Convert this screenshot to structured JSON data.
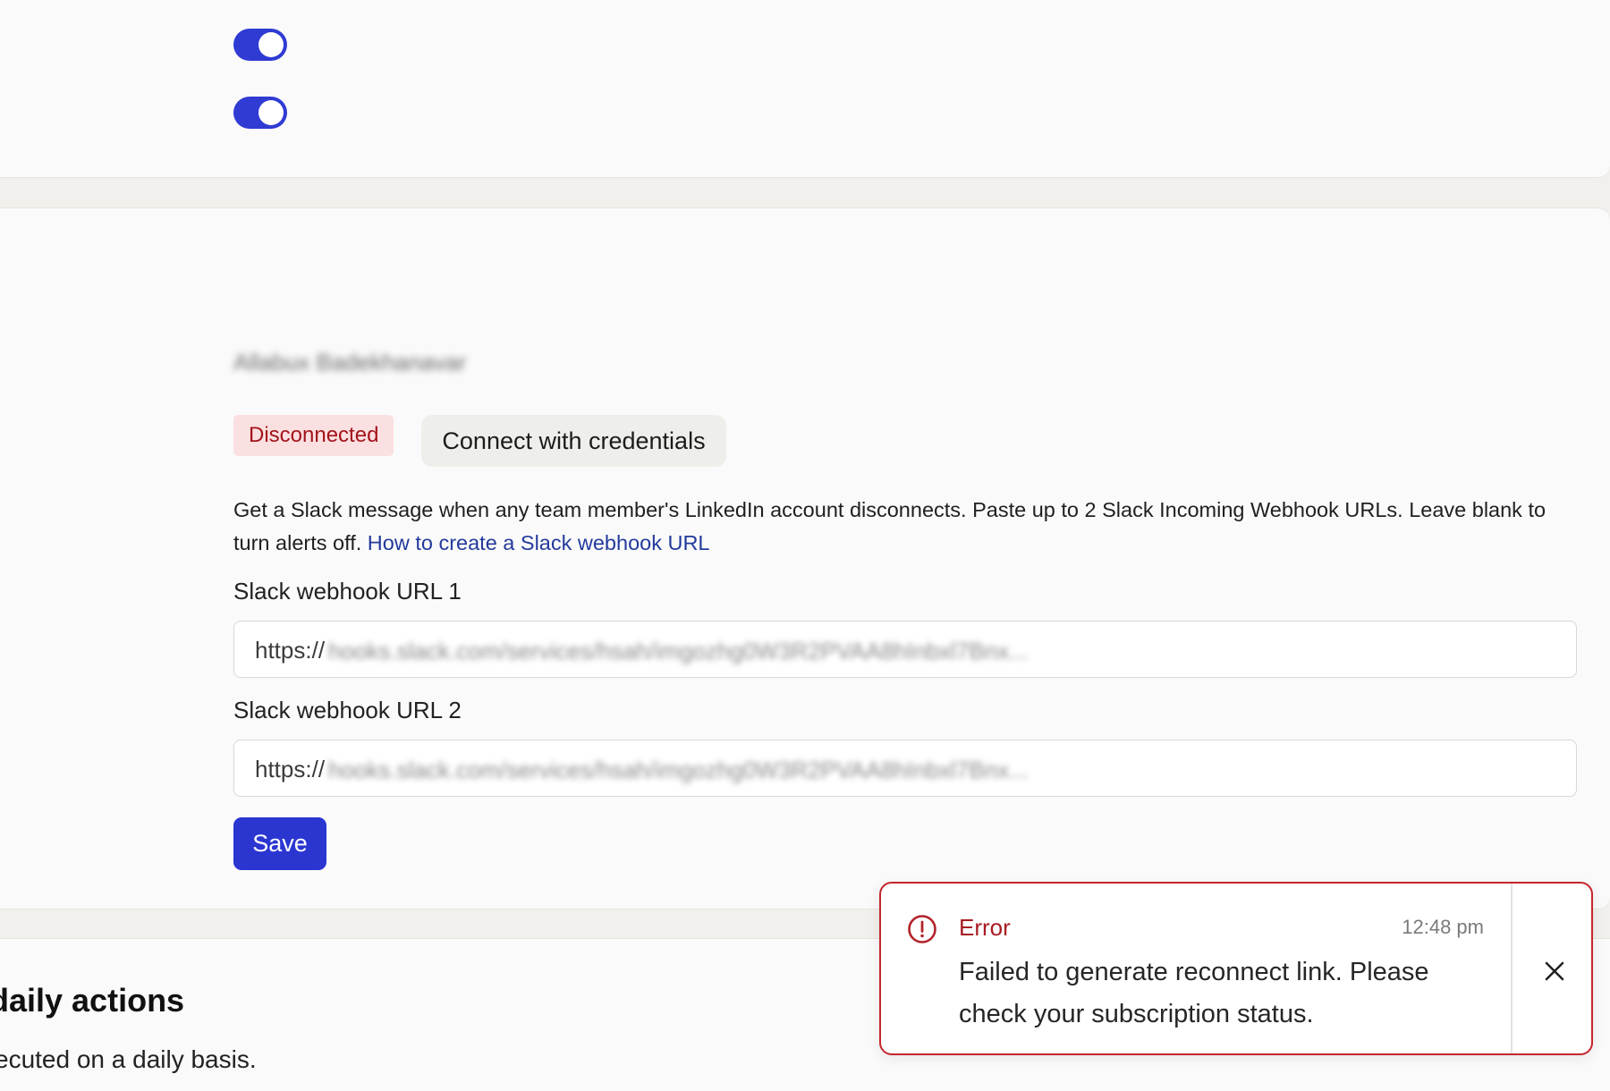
{
  "notifications": {
    "toggles": [
      {
        "state": "on"
      },
      {
        "state": "on"
      }
    ]
  },
  "slack_alerts": {
    "account_name": "Allabux Badekhanavar",
    "status_badge": "Disconnected",
    "connect_button": "Connect with credentials",
    "description": "Get a Slack message when any team member's LinkedIn account disconnects. Paste up to 2 Slack Incoming Webhook URLs. Leave blank to turn alerts off.",
    "help_link": "How to create a Slack webhook URL",
    "webhooks": [
      {
        "label": "Slack webhook URL 1",
        "prefix": "https://",
        "value": "hooks.slack.com/services/hsah/imgozhg0W3R2PVAA8hInbxl7Bnx..."
      },
      {
        "label": "Slack webhook URL 2",
        "prefix": "https://",
        "value": "hooks.slack.com/services/hsah/imgozhg0W3R2PVAA8hInbxl7Bnx..."
      }
    ],
    "save_button": "Save"
  },
  "daily_actions": {
    "title": "daily actions",
    "subtitle": "ecuted on a daily basis."
  },
  "toast": {
    "type": "Error",
    "time": "12:48 pm",
    "message": "Failed to generate reconnect link. Please check your subscription status.",
    "icon": "alert-circle-icon",
    "close_icon": "close-icon"
  },
  "colors": {
    "accent": "#2f3bd3",
    "error": "#c5262d",
    "badge_bg": "#fbe0e1",
    "link": "#233a9c"
  }
}
